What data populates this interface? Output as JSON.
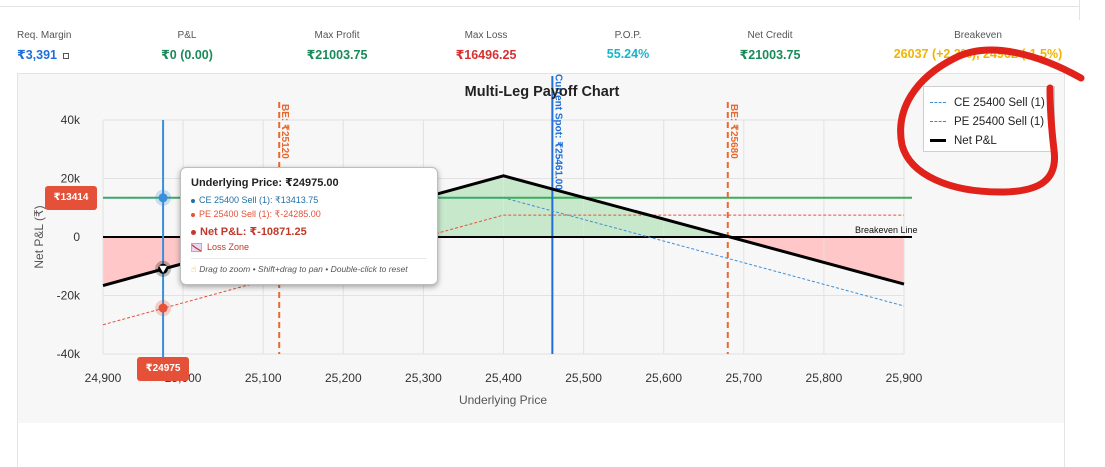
{
  "metrics": [
    {
      "label": "Req. Margin",
      "value": "₹3,391",
      "icon": "square-outline-icon",
      "color": "#1e6fd9"
    },
    {
      "label": "P&L",
      "value": "₹0 (0.00)",
      "color": "#1a8a5a"
    },
    {
      "label": "Max Profit",
      "value": "₹21003.75",
      "color": "#1a8a5a"
    },
    {
      "label": "Max Loss",
      "value": "₹16496.25",
      "color": "#d63031"
    },
    {
      "label": "P.O.P.",
      "value": "55.24%",
      "color": "#17b5c9"
    },
    {
      "label": "Net Credit",
      "value": "₹21003.75",
      "color": "#1a8a5a"
    },
    {
      "label": "Breakeven",
      "value": "26037 (+2.3%), 24962 (-1.5%)",
      "color": "#f0b400"
    }
  ],
  "chart_data": {
    "type": "line",
    "title": "Multi-Leg Payoff Chart",
    "xlabel": "Underlying Price",
    "ylabel": "Net P&L (₹)",
    "xlim": [
      24900,
      25900
    ],
    "ylim": [
      -40000,
      40000
    ],
    "x_ticks": [
      "24,900",
      "25,000",
      "25,100",
      "25,200",
      "25,300",
      "25,400",
      "25,500",
      "25,600",
      "25,700",
      "25,800",
      "25,900"
    ],
    "y_ticks": [
      "40k",
      "20k",
      "0",
      "-20k",
      "-40k"
    ],
    "y_tick_values": [
      40000,
      20000,
      0,
      -20000,
      -40000
    ],
    "grid": true,
    "legend_position": "top-right",
    "series": [
      {
        "name": "CE 25400 Sell (1)",
        "color": "#3b8fd9",
        "style": "dashed",
        "x": [
          24900,
          25400,
          25900
        ],
        "y": [
          13414,
          13414,
          -23586
        ]
      },
      {
        "name": "PE 25400 Sell (1)",
        "color": "#e55039",
        "style": "dashed",
        "x": [
          24900,
          25400,
          25900
        ],
        "y": [
          -30000,
          7500,
          7500
        ]
      },
      {
        "name": "Net P&L",
        "color": "#000000",
        "style": "solid",
        "x": [
          24900,
          25400,
          25900
        ],
        "y": [
          -16586,
          20914,
          -16086
        ]
      }
    ],
    "reference_lines": [
      {
        "label": "BE: ₹25120",
        "axis": "x",
        "value": 25120,
        "color": "#e8692f",
        "style": "dashed"
      },
      {
        "label": "Current Spot: ₹25461.00",
        "axis": "x",
        "value": 25461,
        "color": "#1e6fd9",
        "style": "solid"
      },
      {
        "label": "BE: ₹25680",
        "axis": "x",
        "value": 25680,
        "color": "#e8692f",
        "style": "dashed"
      },
      {
        "label": "Breakeven Line",
        "axis": "y",
        "value": 0,
        "color": "#000000",
        "style": "solid"
      }
    ],
    "horizontal_level": {
      "value": 13414,
      "color": "#3cae5a"
    },
    "crosshair": {
      "x": 24975,
      "x_label": "₹24975",
      "y": 13414,
      "y_label": "₹13414",
      "points": [
        {
          "series": "CE 25400 Sell (1)",
          "y": 13413.75
        },
        {
          "series": "Net P&L",
          "y": -10871.25
        },
        {
          "series": "PE 25400 Sell (1)",
          "y": -24285
        }
      ]
    },
    "zones": {
      "profit_color": "#bfe5c4",
      "loss_color": "#ffc4c4"
    }
  },
  "tooltip": {
    "title": "Underlying Price: ₹24975.00",
    "ce_row": "CE 25400 Sell (1): ₹13413.75",
    "pe_row": "PE 25400 Sell (1): ₹-24285.00",
    "net_row": "Net P&L: ₹-10871.25",
    "zone": "Loss Zone",
    "hint": "Drag to zoom • Shift+drag to pan • Double-click to reset",
    "hint_icon": "pointer-hand-icon",
    "zone_icon": "trend-down-icon"
  },
  "colors": {
    "accent": "#1e6fd9",
    "badge": "#e55039",
    "annotation": "#e0221b"
  }
}
